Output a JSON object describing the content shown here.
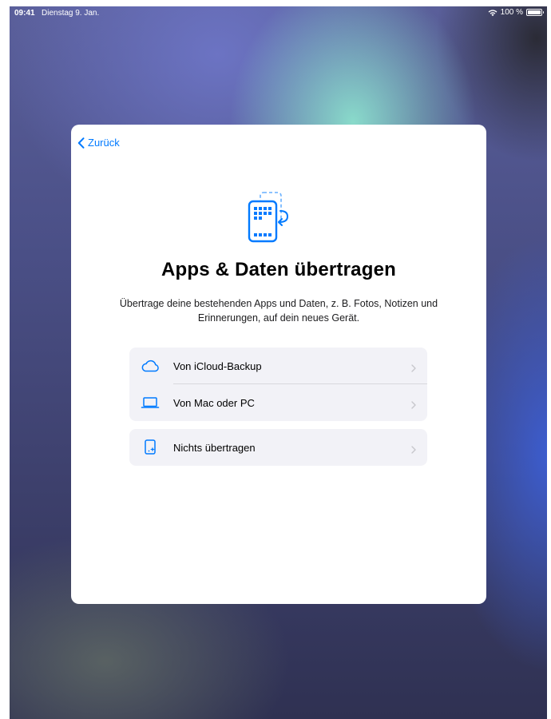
{
  "status_bar": {
    "time": "09:41",
    "date": "Dienstag 9. Jan.",
    "battery_percent": "100 %",
    "wifi_icon": "wifi-icon",
    "battery_icon": "battery-icon"
  },
  "sheet": {
    "back_label": "Zurück",
    "hero_icon": "ipad-transfer-icon",
    "title": "Apps & Daten übertragen",
    "subtitle": "Übertrage deine bestehenden Apps und Daten, z. B. Fotos, Notizen und Erinnerungen, auf dein neues Gerät.",
    "options_group_1": [
      {
        "label": "Von iCloud-Backup",
        "icon": "cloud-icon"
      },
      {
        "label": "Von Mac oder PC",
        "icon": "laptop-icon"
      }
    ],
    "options_group_2": [
      {
        "label": "Nichts übertragen",
        "icon": "new-device-sparkle-icon"
      }
    ]
  },
  "colors": {
    "accent": "#007aff",
    "sheet_background": "#ffffff",
    "row_background": "#f2f2f7",
    "chevron": "#c7c7cc"
  }
}
